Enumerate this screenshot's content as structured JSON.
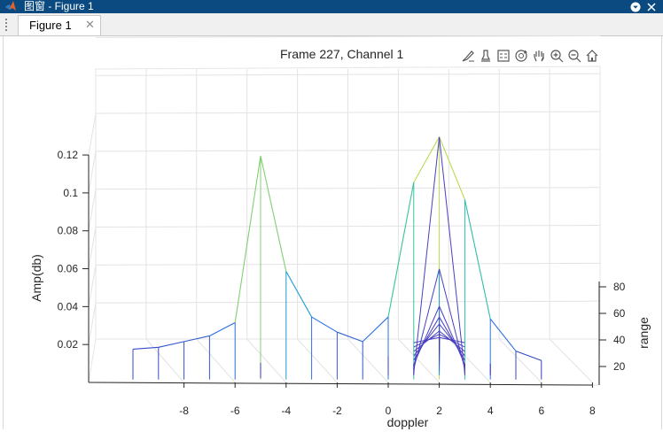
{
  "window": {
    "title": "图窗 - Figure 1",
    "app_icon": "matlab-icon",
    "menu_button_icon": "chevron-down-circle-icon",
    "close_icon": "close-icon",
    "titlebar_color": "#0b4a80"
  },
  "tabs": [
    {
      "label": "Figure 1",
      "close_icon": "close-icon",
      "active": true
    }
  ],
  "toolbar": {
    "icons": [
      "brush-icon",
      "data-tip-icon",
      "legend-icon",
      "rotate-3d-icon",
      "pan-icon",
      "zoom-in-icon",
      "zoom-out-icon",
      "home-icon"
    ]
  },
  "chart_data": {
    "type": "stem3",
    "title": "Frame 227, Channel 1",
    "xlabel": "doppler",
    "ylabel": "range",
    "zlabel": "Amp(db)",
    "xlim": [
      -10,
      10
    ],
    "ylim": [
      10,
      90
    ],
    "zlim": [
      0,
      0.14
    ],
    "x_ticks": [
      "-8",
      "-6",
      "-4",
      "-2",
      "0",
      "2",
      "4",
      "6",
      "8"
    ],
    "y_ticks": [
      "20",
      "40",
      "60",
      "80"
    ],
    "z_ticks": [
      "0.02",
      "0.04",
      "0.06",
      "0.08",
      "0.1",
      "0.12"
    ],
    "grid": true,
    "colormap": [
      "#3d26a8",
      "#2877e8",
      "#16b2c6",
      "#38c39c",
      "#f9e627"
    ],
    "stems": [
      {
        "x": -10,
        "y": 14,
        "z": 0.016
      },
      {
        "x": -9,
        "y": 14,
        "z": 0.017
      },
      {
        "x": -8,
        "y": 14,
        "z": 0.02
      },
      {
        "x": -7,
        "y": 14,
        "z": 0.023
      },
      {
        "x": -6,
        "y": 14,
        "z": 0.03
      },
      {
        "x": -5,
        "y": 14,
        "z": 0.118
      },
      {
        "x": -4,
        "y": 14,
        "z": 0.057
      },
      {
        "x": -3,
        "y": 14,
        "z": 0.033
      },
      {
        "x": -2,
        "y": 14,
        "z": 0.025
      },
      {
        "x": -1,
        "y": 14,
        "z": 0.02
      },
      {
        "x": 0,
        "y": 14,
        "z": 0.033
      },
      {
        "x": 1,
        "y": 14,
        "z": 0.104
      },
      {
        "x": 2,
        "y": 14,
        "z": 0.128
      },
      {
        "x": 3,
        "y": 14,
        "z": 0.095
      },
      {
        "x": 4,
        "y": 14,
        "z": 0.032
      },
      {
        "x": 5,
        "y": 14,
        "z": 0.015
      },
      {
        "x": 6,
        "y": 14,
        "z": 0.01
      },
      {
        "x": -5,
        "y": 16,
        "z": 0.008
      },
      {
        "x": 0,
        "y": 20,
        "z": 0.01
      },
      {
        "x": 1,
        "y": 20,
        "z": 0.006
      },
      {
        "x": 2,
        "y": 20,
        "z": 0.056
      },
      {
        "x": 3,
        "y": 20,
        "z": 0.006
      },
      {
        "x": 4,
        "y": 20,
        "z": 0.006
      },
      {
        "x": 2,
        "y": 26,
        "z": 0.034
      },
      {
        "x": 2,
        "y": 32,
        "z": 0.026
      },
      {
        "x": 2,
        "y": 38,
        "z": 0.02
      },
      {
        "x": 2,
        "y": 44,
        "z": 0.014
      },
      {
        "x": 2,
        "y": 50,
        "z": 0.01
      },
      {
        "x": 2,
        "y": 56,
        "z": 0.006
      },
      {
        "x": 2,
        "y": 62,
        "z": 0.004
      }
    ]
  }
}
